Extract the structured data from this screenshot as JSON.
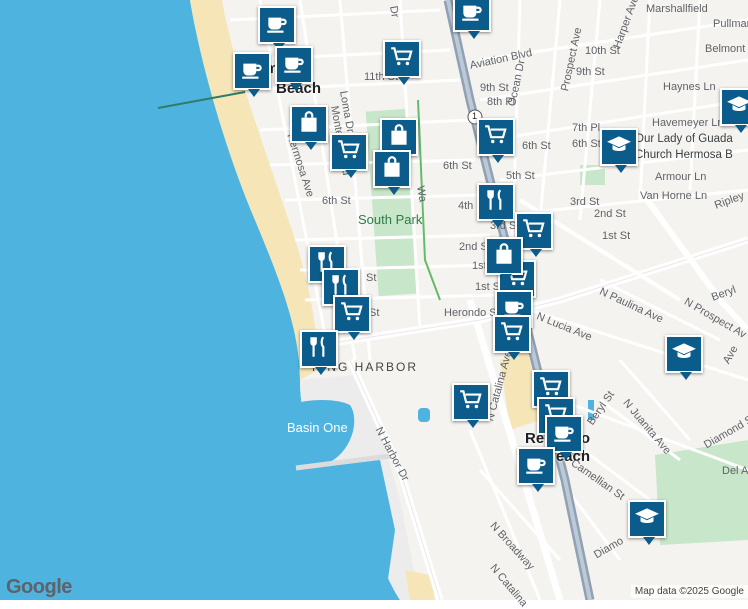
{
  "map": {
    "attribution": "Map data ©2025 Google",
    "logo": "Google"
  },
  "labels": {
    "hermosa": "Hermosa",
    "beach": "Beach",
    "south_park": "South Park",
    "king_harbor": "KING HARBOR",
    "basin_one": "Basin One",
    "redondo": "Redondo",
    "redondo_beach": "Beach",
    "church1": "Our Lady of Guada",
    "church2": "Church Hermosa B",
    "aviation": "Aviation Blvd",
    "ocean_dr": "Ocean Dr",
    "prospect_ave": "Prospect Ave",
    "harper_ave": "Harper Ave",
    "marshallfield": "Marshallfield",
    "pullman": "Pullman",
    "belmont": "Belmont",
    "tenth_st": "10th St",
    "ninth_st_e": "9th St",
    "haynes": "Haynes Ln",
    "havemeyer": "Havemeyer Ln",
    "armour": "Armour Ln",
    "van_horne": "Van Horne Ln",
    "ripley": "Ripley",
    "third_st_e": "3rd St",
    "second_st_e": "2nd St",
    "first_st_e": "1st St",
    "seventh_pl": "7th Pl",
    "sixth_st_e": "6th St",
    "n_paulina": "N Paulina Ave",
    "n_prospect": "N Prospect Av",
    "beryl": "Beryl St",
    "beryl2": "Beryl",
    "n_lucia": "N Lucia Ave",
    "herondo": "Herondo St",
    "n_catalina": "N Catalina Ave",
    "n_catalina2": "N Catalina",
    "n_juanita": "N Juanita Ave",
    "diamond": "Diamond St",
    "diamond2": "Diamo",
    "camellian": "Camellian St",
    "del_a": "Del A",
    "n_harbor": "N Harbor Dr",
    "n_broadway": "N Broadway",
    "loma": "Loma Dr",
    "monterey": "Monterey Blvd",
    "hermosa_ave": "Hermosa Ave",
    "eleventh": "11th St",
    "ninth_st": "9th St",
    "eighth_pl": "8th Pl",
    "sixth_st_m": "6th St",
    "fifth_st": "5th St",
    "fourth_st": "4th St",
    "sixth_st_w": "6th St",
    "third_st_w": "3rd St",
    "second_st_w": "2nd S",
    "first_st": "1st",
    "first_st2": "1st St",
    "route_1": "1",
    "st_frag": "St",
    "dr_frag": "Dr",
    "ave_frag": "Ave",
    "wa_frag": "Wa"
  },
  "markers": [
    {
      "type": "coffee-icon"
    },
    {
      "type": "coffee-icon"
    },
    {
      "type": "coffee-icon"
    },
    {
      "type": "coffee-icon"
    },
    {
      "type": "cart-icon"
    },
    {
      "type": "bag-icon"
    },
    {
      "type": "cart-icon"
    },
    {
      "type": "bag-icon"
    },
    {
      "type": "bag-icon"
    },
    {
      "type": "cart-icon"
    },
    {
      "type": "school-icon"
    },
    {
      "type": "school-icon"
    },
    {
      "type": "restaurant-icon"
    },
    {
      "type": "cart-icon"
    },
    {
      "type": "cart-icon"
    },
    {
      "type": "bag-icon"
    },
    {
      "type": "restaurant-icon"
    },
    {
      "type": "restaurant-icon"
    },
    {
      "type": "cart-icon"
    },
    {
      "type": "restaurant-icon"
    },
    {
      "type": "coffee-icon"
    },
    {
      "type": "cart-icon"
    },
    {
      "type": "school-icon"
    },
    {
      "type": "cart-icon"
    },
    {
      "type": "cart-icon"
    },
    {
      "type": "cart-icon"
    },
    {
      "type": "coffee-icon"
    },
    {
      "type": "coffee-icon"
    },
    {
      "type": "school-icon"
    }
  ],
  "colors": {
    "water": "#4fb3df",
    "sand": "#f6e6b7",
    "land": "#f5f3ef",
    "park": "#c8e6c9",
    "marker": "#0b5c8a",
    "highway": "#8fa1b3"
  }
}
